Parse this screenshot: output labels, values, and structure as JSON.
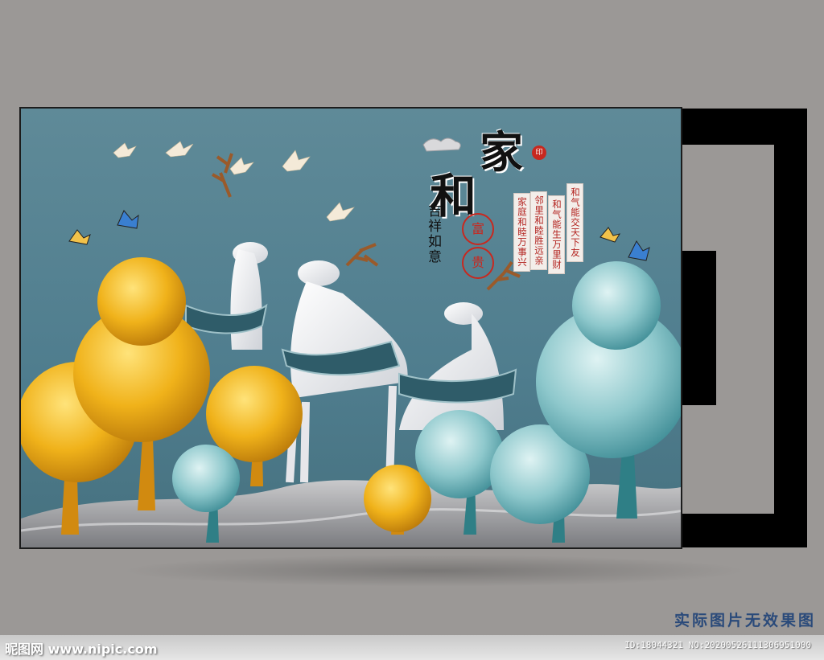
{
  "artwork": {
    "title_chars": [
      "家",
      "和"
    ],
    "seal_text": "印",
    "side_calligraphy": "吉祥如意",
    "circle_chars": [
      "富",
      "贵"
    ],
    "couplets": [
      "和气能交天下友",
      "和气能生万里财",
      "邻里和睦胜远亲",
      "家庭和睦万事兴"
    ]
  },
  "caption": "实际图片无效果图",
  "watermark": {
    "site": "昵图网 www.nipic.com",
    "id": "ID:18044321 NO:20200526111306951000"
  },
  "colors": {
    "background": "#5f8a98",
    "gold_tree": "#f0b21a",
    "teal_tree": "#7fb9c0",
    "deer": "#f2f0f2",
    "seal_red": "#c8281f"
  }
}
